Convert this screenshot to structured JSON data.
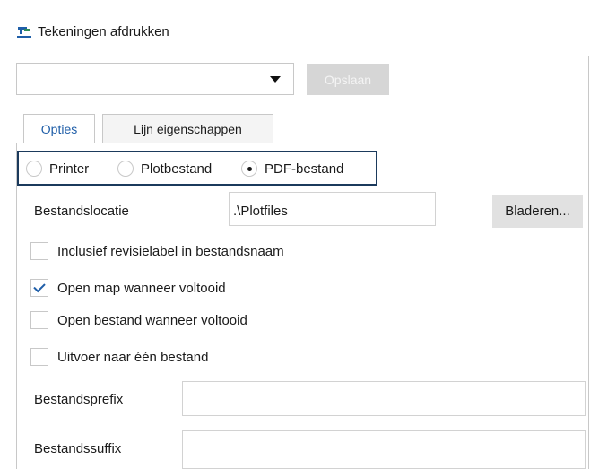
{
  "window": {
    "title": "Tekeningen afdrukken",
    "icon": "plot-drawing-icon"
  },
  "toolbar": {
    "preset_value": "",
    "save_label": "Opslaan"
  },
  "tabs": [
    {
      "label": "Opties",
      "active": true
    },
    {
      "label": "Lijn eigenschappen",
      "active": false
    }
  ],
  "output": {
    "options": [
      {
        "label": "Printer",
        "selected": false
      },
      {
        "label": "Plotbestand",
        "selected": false
      },
      {
        "label": "PDF-bestand",
        "selected": true
      }
    ]
  },
  "location": {
    "label": "Bestandslocatie",
    "value": ".\\Plotfiles",
    "browse_label": "Bladeren..."
  },
  "checkboxes": [
    {
      "label": "Inclusief revisielabel in bestandsnaam",
      "checked": false
    },
    {
      "label": "Open map wanneer voltooid",
      "checked": true
    },
    {
      "label": "Open bestand wanneer voltooid",
      "checked": false
    },
    {
      "label": "Uitvoer naar één bestand",
      "checked": false
    }
  ],
  "prefix": {
    "label": "Bestandsprefix",
    "value": ""
  },
  "suffix": {
    "label": "Bestandssuffix",
    "value": ""
  },
  "colors": {
    "accent": "#1f5ea8",
    "highlight_border": "#1b3a5c",
    "disabled_button": "#d6d6d6"
  }
}
